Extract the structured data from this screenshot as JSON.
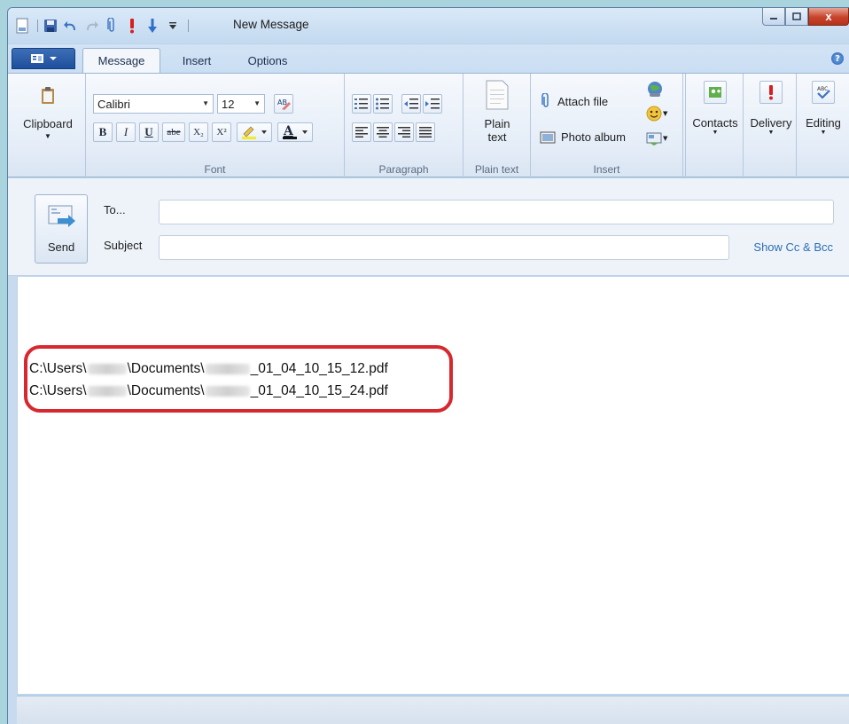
{
  "window": {
    "title": "New Message"
  },
  "title_buttons": {
    "minimize": "–",
    "maximize": "□",
    "close": "x"
  },
  "tabs": [
    {
      "label": "Message",
      "active": true
    },
    {
      "label": "Insert",
      "active": false
    },
    {
      "label": "Options",
      "active": false
    }
  ],
  "ribbon": {
    "clipboard": {
      "label": "Clipboard"
    },
    "font": {
      "group_label": "Font",
      "font_name": "Calibri",
      "font_size": "12",
      "bold": "B",
      "italic": "I",
      "underline": "U",
      "strike": "abe",
      "subscript": "X₂",
      "superscript": "X²",
      "font_color": "A"
    },
    "paragraph": {
      "group_label": "Paragraph"
    },
    "plain_text": {
      "group_label": "Plain text",
      "button_line1": "Plain",
      "button_line2": "text"
    },
    "insert": {
      "group_label": "Insert",
      "attach_file": "Attach file",
      "photo_album": "Photo album"
    },
    "contacts": "Contacts",
    "delivery": "Delivery",
    "editing": "Editing"
  },
  "header": {
    "send": "Send",
    "to_label": "To...",
    "subject_label": "Subject",
    "show_cc_bcc": "Show Cc & Bcc",
    "to_value": "",
    "subject_value": ""
  },
  "body": {
    "attachments": [
      {
        "prefix": "C:\\Users\\",
        "middle": "\\Documents\\",
        "suffix": "_01_04_10_15_12.pdf"
      },
      {
        "prefix": "C:\\Users\\",
        "middle": "\\Documents\\",
        "suffix": "_01_04_10_15_24.pdf"
      }
    ]
  },
  "colors": {
    "highlight_border": "#d8282f",
    "link": "#2d6db5",
    "accent": "#1d4f9c"
  }
}
